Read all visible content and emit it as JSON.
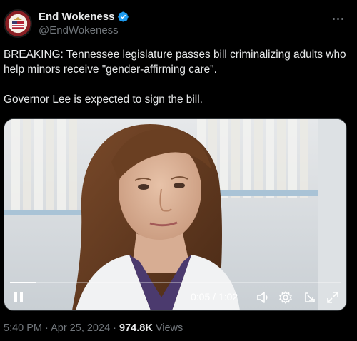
{
  "author": {
    "display_name": "End Wokeness",
    "handle": "@EndWokeness",
    "verified": true,
    "avatar_icon": "end-wokeness-seal"
  },
  "tweet": {
    "text": "BREAKING: Tennessee legislature passes bill criminalizing adults who help minors receive \"gender-affirming care\".\n\nGovernor Lee is expected to sign the bill."
  },
  "video": {
    "elapsed": "0:05",
    "duration": "1:02",
    "time_display": "0:05 / 1:02",
    "progress": 0.08,
    "icons": [
      "pause-icon",
      "volume-icon",
      "settings-icon",
      "popout-icon",
      "fullscreen-icon"
    ]
  },
  "meta": {
    "time": "5:40 PM",
    "date": "Apr 25, 2024",
    "views_count": "974.8K",
    "views_label": "Views"
  },
  "colors": {
    "background": "#000000",
    "text": "#e7e9ea",
    "secondary": "#71767b",
    "verified": "#1d9bf0"
  }
}
